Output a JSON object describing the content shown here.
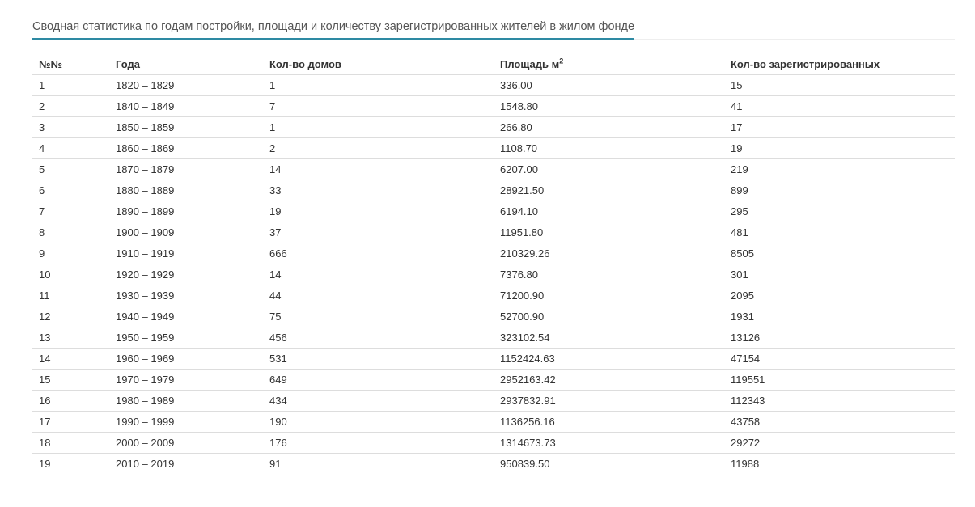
{
  "header": {
    "title": "Сводная статистика по годам постройки, площади и количеству зарегистрированных жителей в жилом фонде"
  },
  "table": {
    "columns": {
      "num": "№№",
      "years": "Года",
      "houses": "Кол-во домов",
      "area": "Площадь м",
      "area_sup": "2",
      "residents": "Кол-во зарегистрированных"
    },
    "rows": [
      {
        "num": "1",
        "years": "1820 – 1829",
        "houses": "1",
        "area": "336.00",
        "residents": "15"
      },
      {
        "num": "2",
        "years": "1840 – 1849",
        "houses": "7",
        "area": "1548.80",
        "residents": "41"
      },
      {
        "num": "3",
        "years": "1850 – 1859",
        "houses": "1",
        "area": "266.80",
        "residents": "17"
      },
      {
        "num": "4",
        "years": "1860 – 1869",
        "houses": "2",
        "area": "1108.70",
        "residents": "19"
      },
      {
        "num": "5",
        "years": "1870 – 1879",
        "houses": "14",
        "area": "6207.00",
        "residents": "219"
      },
      {
        "num": "6",
        "years": "1880 – 1889",
        "houses": "33",
        "area": "28921.50",
        "residents": "899"
      },
      {
        "num": "7",
        "years": "1890 – 1899",
        "houses": "19",
        "area": "6194.10",
        "residents": "295"
      },
      {
        "num": "8",
        "years": "1900 – 1909",
        "houses": "37",
        "area": "11951.80",
        "residents": "481"
      },
      {
        "num": "9",
        "years": "1910 – 1919",
        "houses": "666",
        "area": "210329.26",
        "residents": "8505"
      },
      {
        "num": "10",
        "years": "1920 – 1929",
        "houses": "14",
        "area": "7376.80",
        "residents": "301"
      },
      {
        "num": "11",
        "years": "1930 – 1939",
        "houses": "44",
        "area": "71200.90",
        "residents": "2095"
      },
      {
        "num": "12",
        "years": "1940 – 1949",
        "houses": "75",
        "area": "52700.90",
        "residents": "1931"
      },
      {
        "num": "13",
        "years": "1950 – 1959",
        "houses": "456",
        "area": "323102.54",
        "residents": "13126"
      },
      {
        "num": "14",
        "years": "1960 – 1969",
        "houses": "531",
        "area": "1152424.63",
        "residents": "47154"
      },
      {
        "num": "15",
        "years": "1970 – 1979",
        "houses": "649",
        "area": "2952163.42",
        "residents": "119551"
      },
      {
        "num": "16",
        "years": "1980 – 1989",
        "houses": "434",
        "area": "2937832.91",
        "residents": "112343"
      },
      {
        "num": "17",
        "years": "1990 – 1999",
        "houses": "190",
        "area": "1136256.16",
        "residents": "43758"
      },
      {
        "num": "18",
        "years": "2000 – 2009",
        "houses": "176",
        "area": "1314673.73",
        "residents": "29272"
      },
      {
        "num": "19",
        "years": "2010 – 2019",
        "houses": "91",
        "area": "950839.50",
        "residents": "11988"
      }
    ]
  },
  "colors": {
    "accent": "#2e8aa3",
    "border": "#dddddd",
    "text": "#333333"
  }
}
